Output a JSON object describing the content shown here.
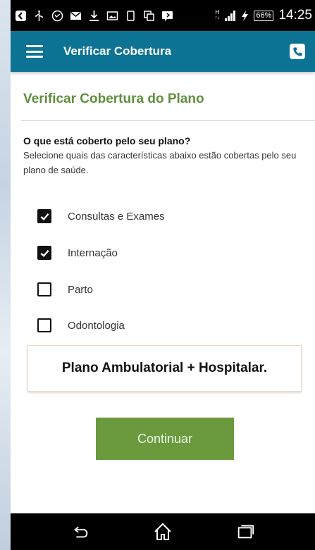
{
  "status_bar": {
    "battery": "66%",
    "time": "14:25",
    "network_label": "H"
  },
  "app_bar": {
    "title": "Verificar Cobertura"
  },
  "main": {
    "section_title": "Verificar Cobertura do Plano",
    "question": "O que está coberto pelo seu plano?",
    "instructions": "Selecione quais das características abaixo estão cobertas pelo seu plano de saúde.",
    "options": [
      {
        "label": "Consultas e Exames",
        "checked": true
      },
      {
        "label": "Internação",
        "checked": true
      },
      {
        "label": "Parto",
        "checked": false
      },
      {
        "label": "Odontologia",
        "checked": false
      }
    ],
    "plan_result": "Plano Ambulatorial + Hospitalar.",
    "continue_label": "Continuar"
  },
  "colors": {
    "app_bar": "#0d7394",
    "accent_green": "#6a9a3d",
    "title_green": "#5f8f3d"
  }
}
